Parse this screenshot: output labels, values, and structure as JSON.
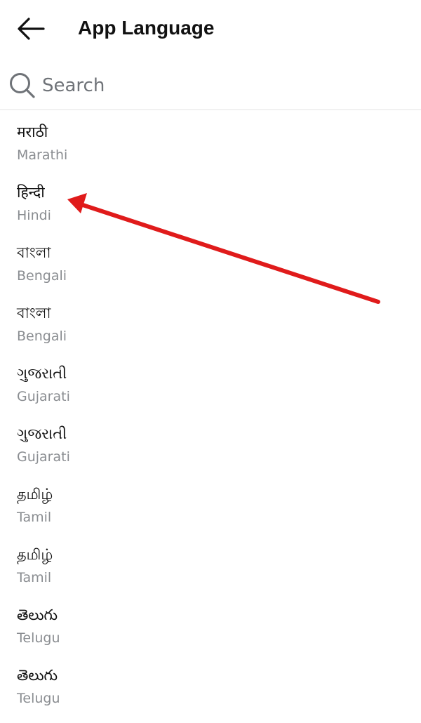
{
  "header": {
    "title": "App Language",
    "back_icon": "arrow-left-icon"
  },
  "search": {
    "placeholder": "Search",
    "value": "",
    "icon": "search-icon"
  },
  "languages": [
    {
      "native": "मराठी",
      "english": "Marathi"
    },
    {
      "native": "हिन्दी",
      "english": "Hindi"
    },
    {
      "native": "বাংলা",
      "english": "Bengali"
    },
    {
      "native": "বাংলা",
      "english": "Bengali"
    },
    {
      "native": "ગુજરાતી",
      "english": "Gujarati"
    },
    {
      "native": "ગુજરાતી",
      "english": "Gujarati"
    },
    {
      "native": "தமிழ்",
      "english": "Tamil"
    },
    {
      "native": "தமிழ்",
      "english": "Tamil"
    },
    {
      "native": "తెలుగు",
      "english": "Telugu"
    },
    {
      "native": "తెలుగు",
      "english": "Telugu"
    }
  ],
  "colors": {
    "title_text": "#111111",
    "secondary_text": "#8a8d91",
    "divider": "#e3e3e3",
    "annotation_arrow": "#e01b1b"
  }
}
